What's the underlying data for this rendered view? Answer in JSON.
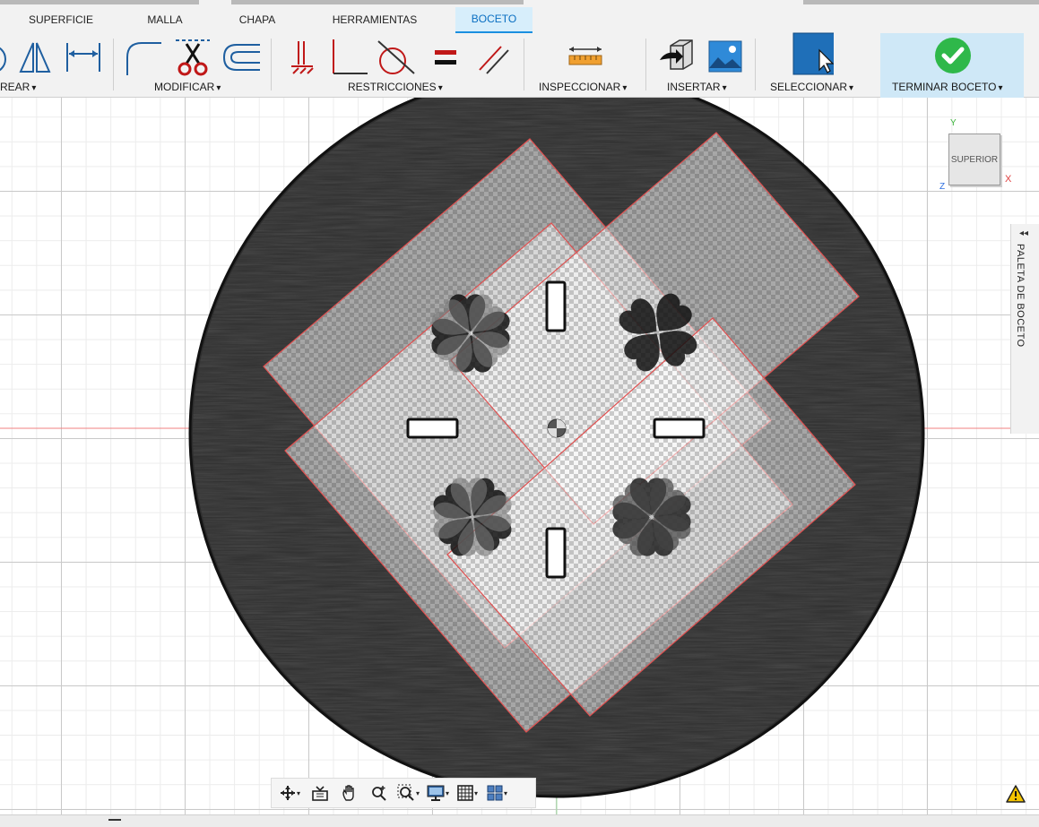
{
  "tabs": [
    {
      "label": "SUPERFICIE"
    },
    {
      "label": "MALLA"
    },
    {
      "label": "CHAPA"
    },
    {
      "label": "HERRAMIENTAS"
    },
    {
      "label": "BOCETO"
    }
  ],
  "active_tab": "BOCETO",
  "ribbon": {
    "create_label": "REAR",
    "modify_label": "MODIFICAR",
    "constraints_label": "RESTRICCIONES",
    "inspect_label": "INSPECCIONAR",
    "insert_label": "INSERTAR",
    "select_label": "SELECCIONAR",
    "finish_label": "TERMINAR BOCETO"
  },
  "icons": {
    "create": [
      "circle-icon",
      "mirror-triangle-icon",
      "dimension-icon"
    ],
    "modify": [
      "fillet-icon",
      "trim-scissors-icon",
      "offset-icon"
    ],
    "constraints": [
      "fix-icon",
      "perpendicular-icon",
      "tangent-icon",
      "equal-icon",
      "parallel-icon"
    ],
    "inspect": [
      "measure-ruler-icon"
    ],
    "insert": [
      "insert-derive-icon",
      "insert-image-icon"
    ],
    "select": [
      "select-cursor-icon"
    ],
    "finish": [
      "checkmark-icon"
    ]
  },
  "colors": {
    "accent": "#1a8fe0",
    "active_tab_bg": "#d7eefb",
    "finish_bg": "#cfe8f7",
    "finish_check": "#2fb84a",
    "sketch_line": "#e05050",
    "disc": "#2e2e2e"
  },
  "viewcube": {
    "face_label": "SUPERIOR",
    "axis_y": "Y",
    "axis_x": "X",
    "axis_z": "Z"
  },
  "palette": {
    "label": "PALETA DE BOCETO",
    "arrow": "◂◂"
  },
  "navbar": {
    "icons": [
      "orbit-icon",
      "look-at-icon",
      "pan-hand-icon",
      "zoom-icon",
      "zoom-window-icon",
      "display-settings-icon",
      "grid-icon",
      "viewports-icon"
    ]
  },
  "status": {
    "warning_icon": "warning-icon"
  }
}
